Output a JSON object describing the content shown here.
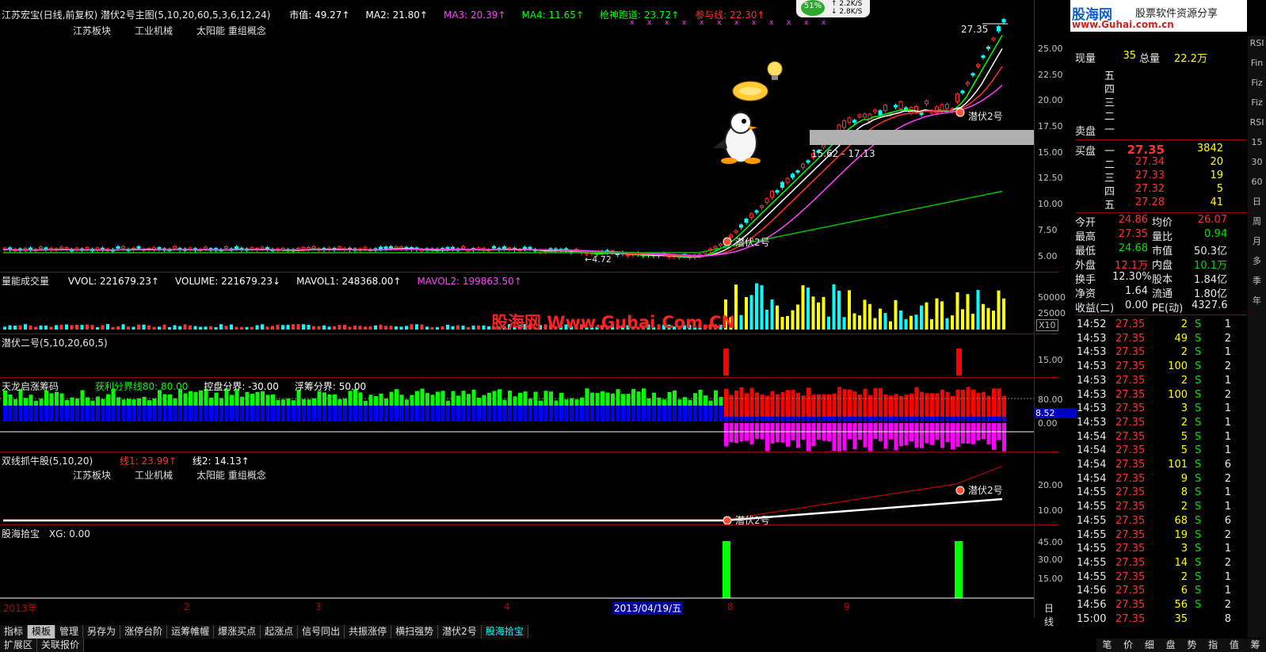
{
  "main": {
    "title": "江苏宏宝(日线,前复权) 潜伏2号主图(5,10,20,60,5,3,6,12,24)",
    "values": [
      {
        "label": "市值: 49.27↑",
        "color": "#ffffff"
      },
      {
        "label": "MA2: 21.80↑",
        "color": "#ffffff"
      },
      {
        "label": "MA3: 20.39↑",
        "color": "#ff40ff"
      },
      {
        "label": "MA4: 11.65↑",
        "color": "#00ff00"
      },
      {
        "label": "枪神跑道: 23.72↑",
        "color": "#00ff00"
      },
      {
        "label": "参与线: 22.30↑",
        "color": "#ff3030"
      }
    ],
    "tags": [
      "江苏板块",
      "工业机械",
      "太阳能 重组概念"
    ],
    "high_label": "27.35",
    "range_label": "15.62 - 17.13",
    "low_label": "←4.72",
    "signal_label": "潜伏2号",
    "axis": [
      "25.00",
      "22.50",
      "20.00",
      "17.50",
      "15.00",
      "12.50",
      "10.00",
      "7.50",
      "5.00"
    ]
  },
  "volume": {
    "title": "量能成交量",
    "values": [
      {
        "label": "VVOL: 221679.23↑",
        "color": "#ffffff"
      },
      {
        "label": "VOLUME: 221679.23↓",
        "color": "#ffffff"
      },
      {
        "label": "MAVOL1: 248368.00↑",
        "color": "#ffffff"
      },
      {
        "label": "MAVOL2: 199863.50↑",
        "color": "#ff40ff"
      }
    ],
    "axis": [
      "50000",
      "25000"
    ],
    "unit": "X10"
  },
  "watermark": "股海网 Www.Guhai.Com.CN",
  "qianfu": {
    "title": "潜伏二号(5,10,20,60,5)",
    "axis": [
      "15.00"
    ]
  },
  "tianlong": {
    "title": "天龙启涨筹码",
    "values": [
      {
        "label": "获利分界线80: 80.00",
        "color": "#00ff00"
      },
      {
        "label": "控盘分界: -30.00",
        "color": "#ffffff"
      },
      {
        "label": "浮筹分界: 50.00",
        "color": "#ffffff"
      }
    ],
    "axis": [
      "80.00",
      "0.00"
    ],
    "current": "8.52"
  },
  "shuangxian": {
    "title": "双线抓牛股(5,10,20)",
    "values": [
      {
        "label": "线1: 23.99↑",
        "color": "#ff3030"
      },
      {
        "label": "线2: 14.13↑",
        "color": "#ffffff"
      }
    ],
    "tags": [
      "江苏板块",
      "工业机械",
      "太阳能 重组概念"
    ],
    "axis": [
      "20.00",
      "10.00"
    ]
  },
  "guhai": {
    "title": "股海拾宝",
    "value": "XG: 0.00",
    "axis": [
      "45.00",
      "30.00",
      "15.00"
    ]
  },
  "time_axis": {
    "year": "2013年",
    "marks": [
      "2",
      "3",
      "4",
      "8",
      "9"
    ],
    "cursor_date": "2013/04/19/五",
    "period": "日线"
  },
  "tabs": [
    "指标",
    "模板",
    "管理",
    "另存为",
    "涨停台阶",
    "运筹帷幄",
    "爆涨买点",
    "起涨点",
    "信号同出",
    "共振涨停",
    "横扫强势",
    "潜伏2号",
    "股海拾宝"
  ],
  "tabs2": [
    "扩展区",
    "关联报价"
  ],
  "quote": {
    "logo": "股海网",
    "logo_sub": "股票软件资源分享",
    "logo_url": "www.Guhai.com.cn",
    "xianliang_label": "现量",
    "xianliang": "35",
    "zongliang_label": "总量",
    "zongliang": "22.2万",
    "sell_label": "卖盘",
    "sell_levels": [
      "五",
      "四",
      "三",
      "二",
      "一"
    ],
    "buy_label": "买盘",
    "buy": [
      {
        "lvl": "一",
        "price": "27.35",
        "vol": "3842"
      },
      {
        "lvl": "二",
        "price": "27.34",
        "vol": "20"
      },
      {
        "lvl": "三",
        "price": "27.33",
        "vol": "19"
      },
      {
        "lvl": "四",
        "price": "27.32",
        "vol": "5"
      },
      {
        "lvl": "五",
        "price": "27.28",
        "vol": "41"
      }
    ],
    "stats": [
      {
        "l1": "今开",
        "v1": "24.86",
        "c1": "#ff3030",
        "l2": "均价",
        "v2": "26.07",
        "c2": "#ff3030"
      },
      {
        "l1": "最高",
        "v1": "27.35",
        "c1": "#ff3030",
        "l2": "量比",
        "v2": "0.94",
        "c2": "#00e000"
      },
      {
        "l1": "最低",
        "v1": "24.68",
        "c1": "#00e000",
        "l2": "市值",
        "v2": "50.3亿",
        "c2": "#e8e8e8"
      },
      {
        "l1": "外盘",
        "v1": "12.1万",
        "c1": "#ff3030",
        "l2": "内盘",
        "v2": "10.1万",
        "c2": "#00e000"
      },
      {
        "l1": "换手",
        "v1": "12.30%",
        "c1": "#e8e8e8",
        "l2": "股本",
        "v2": "1.84亿",
        "c2": "#e8e8e8"
      },
      {
        "l1": "净资",
        "v1": "1.64",
        "c1": "#e8e8e8",
        "l2": "流通",
        "v2": "1.80亿",
        "c2": "#e8e8e8"
      },
      {
        "l1": "收益(二)",
        "v1": "0.00",
        "c1": "#e8e8e8",
        "l2": "PE(动)",
        "v2": "4327.6",
        "c2": "#e8e8e8"
      }
    ],
    "ticks": [
      {
        "t": "14:52",
        "p": "27.35",
        "v": "2",
        "s": "S",
        "n": "1"
      },
      {
        "t": "14:53",
        "p": "27.35",
        "v": "49",
        "s": "S",
        "n": "2"
      },
      {
        "t": "14:53",
        "p": "27.35",
        "v": "2",
        "s": "S",
        "n": "1"
      },
      {
        "t": "14:53",
        "p": "27.35",
        "v": "100",
        "s": "S",
        "n": "2"
      },
      {
        "t": "14:53",
        "p": "27.35",
        "v": "2",
        "s": "S",
        "n": "1"
      },
      {
        "t": "14:53",
        "p": "27.35",
        "v": "100",
        "s": "S",
        "n": "2"
      },
      {
        "t": "14:53",
        "p": "27.35",
        "v": "3",
        "s": "S",
        "n": "1"
      },
      {
        "t": "14:53",
        "p": "27.35",
        "v": "2",
        "s": "S",
        "n": "1"
      },
      {
        "t": "14:54",
        "p": "27.35",
        "v": "5",
        "s": "S",
        "n": "1"
      },
      {
        "t": "14:54",
        "p": "27.35",
        "v": "5",
        "s": "S",
        "n": "1"
      },
      {
        "t": "14:54",
        "p": "27.35",
        "v": "101",
        "s": "S",
        "n": "6"
      },
      {
        "t": "14:54",
        "p": "27.35",
        "v": "9",
        "s": "S",
        "n": "2"
      },
      {
        "t": "14:55",
        "p": "27.35",
        "v": "8",
        "s": "S",
        "n": "1"
      },
      {
        "t": "14:55",
        "p": "27.35",
        "v": "2",
        "s": "S",
        "n": "1"
      },
      {
        "t": "14:55",
        "p": "27.35",
        "v": "68",
        "s": "S",
        "n": "6"
      },
      {
        "t": "14:55",
        "p": "27.35",
        "v": "19",
        "s": "S",
        "n": "2"
      },
      {
        "t": "14:55",
        "p": "27.35",
        "v": "3",
        "s": "S",
        "n": "1"
      },
      {
        "t": "14:55",
        "p": "27.35",
        "v": "14",
        "s": "S",
        "n": "2"
      },
      {
        "t": "14:55",
        "p": "27.35",
        "v": "2",
        "s": "S",
        "n": "1"
      },
      {
        "t": "14:56",
        "p": "27.35",
        "v": "6",
        "s": "S",
        "n": "1"
      },
      {
        "t": "14:56",
        "p": "27.35",
        "v": "56",
        "s": "S",
        "n": "2"
      },
      {
        "t": "15:00",
        "p": "27.35",
        "v": "35",
        "s": "",
        "n": "8"
      }
    ],
    "bottom_tabs": [
      "笔",
      "价",
      "细",
      "盘",
      "势",
      "指",
      "值",
      "筹"
    ]
  },
  "overlay": {
    "percent": "51%",
    "up_speed": "2.2K/S",
    "down_speed": "2.8K/S"
  },
  "toolbar_right": [
    "RSI",
    "Fin",
    "Fiz",
    "Fiz",
    "RSI",
    "15",
    "30",
    "60",
    "日",
    "周",
    "月",
    "多",
    "季",
    "年"
  ]
}
